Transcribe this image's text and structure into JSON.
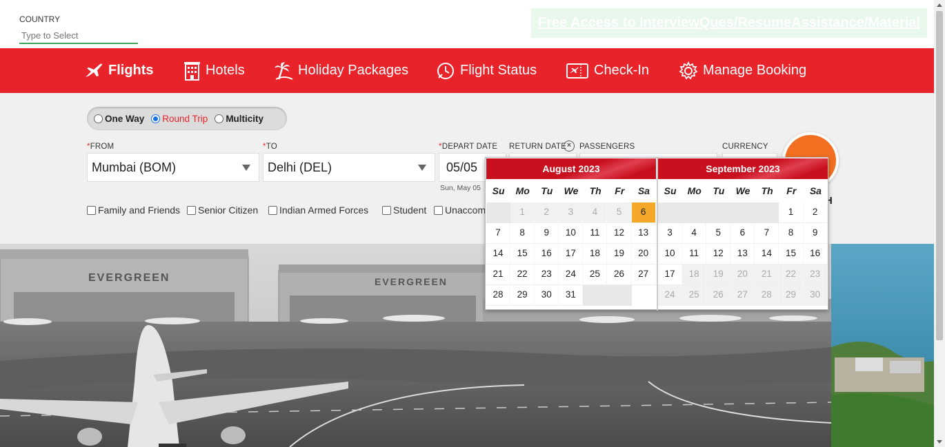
{
  "header": {
    "country_label": "COUNTRY",
    "country_placeholder": "Type to Select",
    "free_link": "Free Access to InterviewQues/ResumeAssistance/Material"
  },
  "nav": {
    "items": [
      {
        "label": "Flights",
        "icon": "plane-icon"
      },
      {
        "label": "Hotels",
        "icon": "hotel-icon"
      },
      {
        "label": "Holiday Packages",
        "icon": "palm-tree-icon"
      },
      {
        "label": "Flight Status",
        "icon": "clock-icon"
      },
      {
        "label": "Check-In",
        "icon": "boarding-pass-icon"
      },
      {
        "label": "Manage Booking",
        "icon": "gear-icon"
      }
    ]
  },
  "search": {
    "trip_types": [
      "One Way",
      "Round Trip",
      "Multicity"
    ],
    "selected_trip": "Round Trip",
    "from_label": "FROM",
    "from_value": "Mumbai (BOM)",
    "to_label": "TO",
    "to_value": "Delhi (DEL)",
    "depart_label": "DEPART DATE",
    "depart_value": "05/05",
    "depart_sub": "Sun, May 05",
    "return_label": "RETURN DATE",
    "passengers_label": "PASSENGERS",
    "currency_label": "CURRENCY",
    "search_text": "H",
    "concessions": [
      "Family and Friends",
      "Senior Citizen",
      "Indian Armed Forces",
      "Student",
      "Unaccom"
    ]
  },
  "calendar": {
    "weekdays": [
      "Su",
      "Mo",
      "Tu",
      "We",
      "Th",
      "Fr",
      "Sa"
    ],
    "months": [
      {
        "title": "August 2023",
        "cells": [
          "",
          "1",
          "2",
          "3",
          "4",
          "5",
          "6",
          "7",
          "8",
          "9",
          "10",
          "11",
          "12",
          "13",
          "14",
          "15",
          "16",
          "17",
          "18",
          "19",
          "20",
          "21",
          "22",
          "23",
          "24",
          "25",
          "26",
          "27",
          "28",
          "29",
          "30",
          "31",
          "",
          ""
        ],
        "disabled": [
          "1",
          "2",
          "3",
          "4",
          "5"
        ],
        "today": "6"
      },
      {
        "title": "September 2023",
        "cells": [
          "",
          "",
          "",
          "",
          "",
          "1",
          "2",
          "3",
          "4",
          "5",
          "6",
          "7",
          "8",
          "9",
          "10",
          "11",
          "12",
          "13",
          "14",
          "15",
          "16",
          "17",
          "18",
          "19",
          "20",
          "21",
          "22",
          "23",
          "24",
          "25",
          "26",
          "27",
          "28",
          "29",
          "30"
        ],
        "disabled": [
          "18",
          "19",
          "20",
          "21",
          "22",
          "23",
          "24",
          "25",
          "26",
          "27",
          "28",
          "29",
          "30"
        ],
        "today": ""
      }
    ]
  }
}
